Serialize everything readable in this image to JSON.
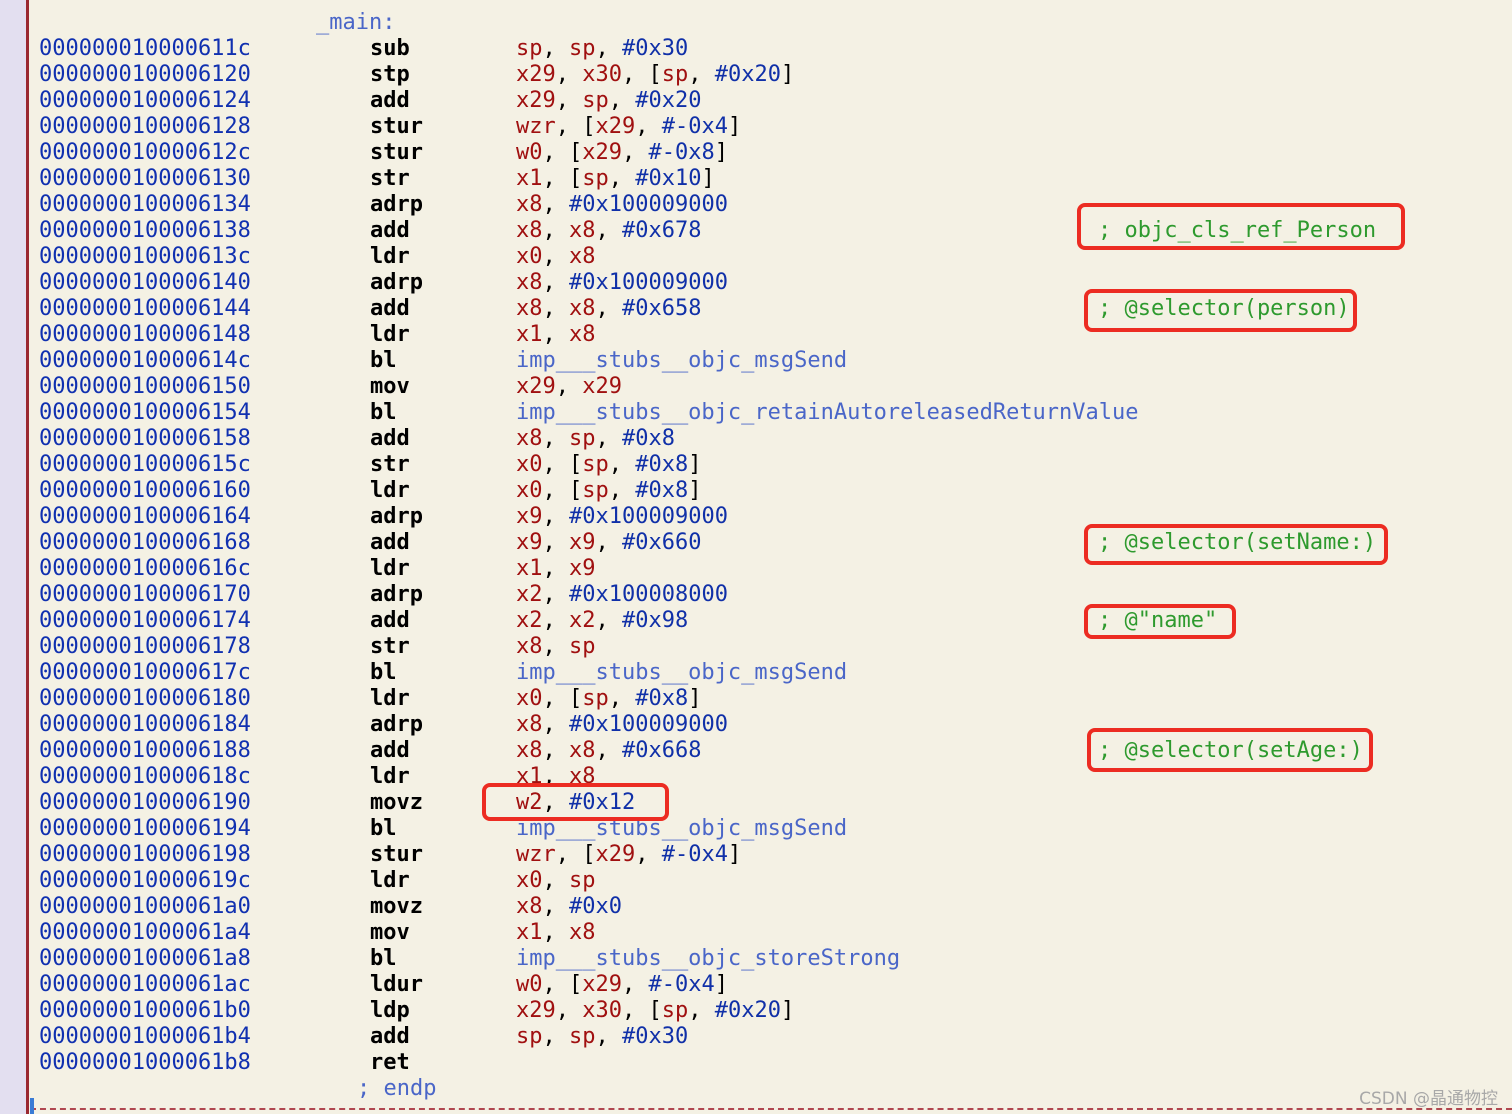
{
  "function_label": "_main:",
  "end_label": "; endp",
  "watermark": "CSDN @晶通物控",
  "colors": {
    "background": "#f4f1e4",
    "address": "#1030b0",
    "register": "#a01010",
    "immediate": "#1030a8",
    "symbol": "#4a66c8",
    "comment": "#2e9a2e",
    "highlight_box": "#ec2c22"
  },
  "instructions": [
    {
      "address": "000000010000611c",
      "mnemonic": "sub",
      "operands": [
        [
          "r",
          "sp"
        ],
        [
          "p",
          ", "
        ],
        [
          "r",
          "sp"
        ],
        [
          "p",
          ", "
        ],
        [
          "i",
          "#0x30"
        ]
      ]
    },
    {
      "address": "0000000100006120",
      "mnemonic": "stp",
      "operands": [
        [
          "r",
          "x29"
        ],
        [
          "p",
          ", "
        ],
        [
          "r",
          "x30"
        ],
        [
          "p",
          ", ["
        ],
        [
          "r",
          "sp"
        ],
        [
          "p",
          ", "
        ],
        [
          "i",
          "#0x20"
        ],
        [
          "p",
          "]"
        ]
      ]
    },
    {
      "address": "0000000100006124",
      "mnemonic": "add",
      "operands": [
        [
          "r",
          "x29"
        ],
        [
          "p",
          ", "
        ],
        [
          "r",
          "sp"
        ],
        [
          "p",
          ", "
        ],
        [
          "i",
          "#0x20"
        ]
      ]
    },
    {
      "address": "0000000100006128",
      "mnemonic": "stur",
      "operands": [
        [
          "r",
          "wzr"
        ],
        [
          "p",
          ", ["
        ],
        [
          "r",
          "x29"
        ],
        [
          "p",
          ", "
        ],
        [
          "i",
          "#-0x4"
        ],
        [
          "p",
          "]"
        ]
      ]
    },
    {
      "address": "000000010000612c",
      "mnemonic": "stur",
      "operands": [
        [
          "r",
          "w0"
        ],
        [
          "p",
          ", ["
        ],
        [
          "r",
          "x29"
        ],
        [
          "p",
          ", "
        ],
        [
          "i",
          "#-0x8"
        ],
        [
          "p",
          "]"
        ]
      ]
    },
    {
      "address": "0000000100006130",
      "mnemonic": "str",
      "operands": [
        [
          "r",
          "x1"
        ],
        [
          "p",
          ", ["
        ],
        [
          "r",
          "sp"
        ],
        [
          "p",
          ", "
        ],
        [
          "i",
          "#0x10"
        ],
        [
          "p",
          "]"
        ]
      ]
    },
    {
      "address": "0000000100006134",
      "mnemonic": "adrp",
      "operands": [
        [
          "r",
          "x8"
        ],
        [
          "p",
          ", "
        ],
        [
          "i",
          "#0x100009000"
        ]
      ]
    },
    {
      "address": "0000000100006138",
      "mnemonic": "add",
      "operands": [
        [
          "r",
          "x8"
        ],
        [
          "p",
          ", "
        ],
        [
          "r",
          "x8"
        ],
        [
          "p",
          ", "
        ],
        [
          "i",
          "#0x678"
        ]
      ],
      "comment": "; objc_cls_ref_Person"
    },
    {
      "address": "000000010000613c",
      "mnemonic": "ldr",
      "operands": [
        [
          "r",
          "x0"
        ],
        [
          "p",
          ", "
        ],
        [
          "r",
          "x8"
        ]
      ]
    },
    {
      "address": "0000000100006140",
      "mnemonic": "adrp",
      "operands": [
        [
          "r",
          "x8"
        ],
        [
          "p",
          ", "
        ],
        [
          "i",
          "#0x100009000"
        ]
      ]
    },
    {
      "address": "0000000100006144",
      "mnemonic": "add",
      "operands": [
        [
          "r",
          "x8"
        ],
        [
          "p",
          ", "
        ],
        [
          "r",
          "x8"
        ],
        [
          "p",
          ", "
        ],
        [
          "i",
          "#0x658"
        ]
      ],
      "comment": "; @selector(person)"
    },
    {
      "address": "0000000100006148",
      "mnemonic": "ldr",
      "operands": [
        [
          "r",
          "x1"
        ],
        [
          "p",
          ", "
        ],
        [
          "r",
          "x8"
        ]
      ]
    },
    {
      "address": "000000010000614c",
      "mnemonic": "bl",
      "operands": [
        [
          "s",
          "imp___stubs__objc_msgSend"
        ]
      ]
    },
    {
      "address": "0000000100006150",
      "mnemonic": "mov",
      "operands": [
        [
          "r",
          "x29"
        ],
        [
          "p",
          ", "
        ],
        [
          "r",
          "x29"
        ]
      ]
    },
    {
      "address": "0000000100006154",
      "mnemonic": "bl",
      "operands": [
        [
          "s",
          "imp___stubs__objc_retainAutoreleasedReturnValue"
        ]
      ]
    },
    {
      "address": "0000000100006158",
      "mnemonic": "add",
      "operands": [
        [
          "r",
          "x8"
        ],
        [
          "p",
          ", "
        ],
        [
          "r",
          "sp"
        ],
        [
          "p",
          ", "
        ],
        [
          "i",
          "#0x8"
        ]
      ]
    },
    {
      "address": "000000010000615c",
      "mnemonic": "str",
      "operands": [
        [
          "r",
          "x0"
        ],
        [
          "p",
          ", ["
        ],
        [
          "r",
          "sp"
        ],
        [
          "p",
          ", "
        ],
        [
          "i",
          "#0x8"
        ],
        [
          "p",
          "]"
        ]
      ]
    },
    {
      "address": "0000000100006160",
      "mnemonic": "ldr",
      "operands": [
        [
          "r",
          "x0"
        ],
        [
          "p",
          ", ["
        ],
        [
          "r",
          "sp"
        ],
        [
          "p",
          ", "
        ],
        [
          "i",
          "#0x8"
        ],
        [
          "p",
          "]"
        ]
      ]
    },
    {
      "address": "0000000100006164",
      "mnemonic": "adrp",
      "operands": [
        [
          "r",
          "x9"
        ],
        [
          "p",
          ", "
        ],
        [
          "i",
          "#0x100009000"
        ]
      ]
    },
    {
      "address": "0000000100006168",
      "mnemonic": "add",
      "operands": [
        [
          "r",
          "x9"
        ],
        [
          "p",
          ", "
        ],
        [
          "r",
          "x9"
        ],
        [
          "p",
          ", "
        ],
        [
          "i",
          "#0x660"
        ]
      ],
      "comment": "; @selector(setName:)"
    },
    {
      "address": "000000010000616c",
      "mnemonic": "ldr",
      "operands": [
        [
          "r",
          "x1"
        ],
        [
          "p",
          ", "
        ],
        [
          "r",
          "x9"
        ]
      ]
    },
    {
      "address": "0000000100006170",
      "mnemonic": "adrp",
      "operands": [
        [
          "r",
          "x2"
        ],
        [
          "p",
          ", "
        ],
        [
          "i",
          "#0x100008000"
        ]
      ]
    },
    {
      "address": "0000000100006174",
      "mnemonic": "add",
      "operands": [
        [
          "r",
          "x2"
        ],
        [
          "p",
          ", "
        ],
        [
          "r",
          "x2"
        ],
        [
          "p",
          ", "
        ],
        [
          "i",
          "#0x98"
        ]
      ],
      "comment": "; @\"name\""
    },
    {
      "address": "0000000100006178",
      "mnemonic": "str",
      "operands": [
        [
          "r",
          "x8"
        ],
        [
          "p",
          ", "
        ],
        [
          "r",
          "sp"
        ]
      ]
    },
    {
      "address": "000000010000617c",
      "mnemonic": "bl",
      "operands": [
        [
          "s",
          "imp___stubs__objc_msgSend"
        ]
      ]
    },
    {
      "address": "0000000100006180",
      "mnemonic": "ldr",
      "operands": [
        [
          "r",
          "x0"
        ],
        [
          "p",
          ", ["
        ],
        [
          "r",
          "sp"
        ],
        [
          "p",
          ", "
        ],
        [
          "i",
          "#0x8"
        ],
        [
          "p",
          "]"
        ]
      ]
    },
    {
      "address": "0000000100006184",
      "mnemonic": "adrp",
      "operands": [
        [
          "r",
          "x8"
        ],
        [
          "p",
          ", "
        ],
        [
          "i",
          "#0x100009000"
        ]
      ]
    },
    {
      "address": "0000000100006188",
      "mnemonic": "add",
      "operands": [
        [
          "r",
          "x8"
        ],
        [
          "p",
          ", "
        ],
        [
          "r",
          "x8"
        ],
        [
          "p",
          ", "
        ],
        [
          "i",
          "#0x668"
        ]
      ],
      "comment": "; @selector(setAge:)"
    },
    {
      "address": "000000010000618c",
      "mnemonic": "ldr",
      "operands": [
        [
          "r",
          "x1"
        ],
        [
          "p",
          ", "
        ],
        [
          "r",
          "x8"
        ]
      ]
    },
    {
      "address": "0000000100006190",
      "mnemonic": "movz",
      "operands": [
        [
          "r",
          "w2"
        ],
        [
          "p",
          ", "
        ],
        [
          "i",
          "#0x12"
        ]
      ]
    },
    {
      "address": "0000000100006194",
      "mnemonic": "bl",
      "operands": [
        [
          "s",
          "imp___stubs__objc_msgSend"
        ]
      ]
    },
    {
      "address": "0000000100006198",
      "mnemonic": "stur",
      "operands": [
        [
          "r",
          "wzr"
        ],
        [
          "p",
          ", ["
        ],
        [
          "r",
          "x29"
        ],
        [
          "p",
          ", "
        ],
        [
          "i",
          "#-0x4"
        ],
        [
          "p",
          "]"
        ]
      ]
    },
    {
      "address": "000000010000619c",
      "mnemonic": "ldr",
      "operands": [
        [
          "r",
          "x0"
        ],
        [
          "p",
          ", "
        ],
        [
          "r",
          "sp"
        ]
      ]
    },
    {
      "address": "00000001000061a0",
      "mnemonic": "movz",
      "operands": [
        [
          "r",
          "x8"
        ],
        [
          "p",
          ", "
        ],
        [
          "i",
          "#0x0"
        ]
      ]
    },
    {
      "address": "00000001000061a4",
      "mnemonic": "mov",
      "operands": [
        [
          "r",
          "x1"
        ],
        [
          "p",
          ", "
        ],
        [
          "r",
          "x8"
        ]
      ]
    },
    {
      "address": "00000001000061a8",
      "mnemonic": "bl",
      "operands": [
        [
          "s",
          "imp___stubs__objc_storeStrong"
        ]
      ]
    },
    {
      "address": "00000001000061ac",
      "mnemonic": "ldur",
      "operands": [
        [
          "r",
          "w0"
        ],
        [
          "p",
          ", ["
        ],
        [
          "r",
          "x29"
        ],
        [
          "p",
          ", "
        ],
        [
          "i",
          "#-0x4"
        ],
        [
          "p",
          "]"
        ]
      ]
    },
    {
      "address": "00000001000061b0",
      "mnemonic": "ldp",
      "operands": [
        [
          "r",
          "x29"
        ],
        [
          "p",
          ", "
        ],
        [
          "r",
          "x30"
        ],
        [
          "p",
          ", ["
        ],
        [
          "r",
          "sp"
        ],
        [
          "p",
          ", "
        ],
        [
          "i",
          "#0x20"
        ],
        [
          "p",
          "]"
        ]
      ]
    },
    {
      "address": "00000001000061b4",
      "mnemonic": "add",
      "operands": [
        [
          "r",
          "sp"
        ],
        [
          "p",
          ", "
        ],
        [
          "r",
          "sp"
        ],
        [
          "p",
          ", "
        ],
        [
          "i",
          "#0x30"
        ]
      ]
    },
    {
      "address": "00000001000061b8",
      "mnemonic": "ret",
      "operands": []
    }
  ]
}
